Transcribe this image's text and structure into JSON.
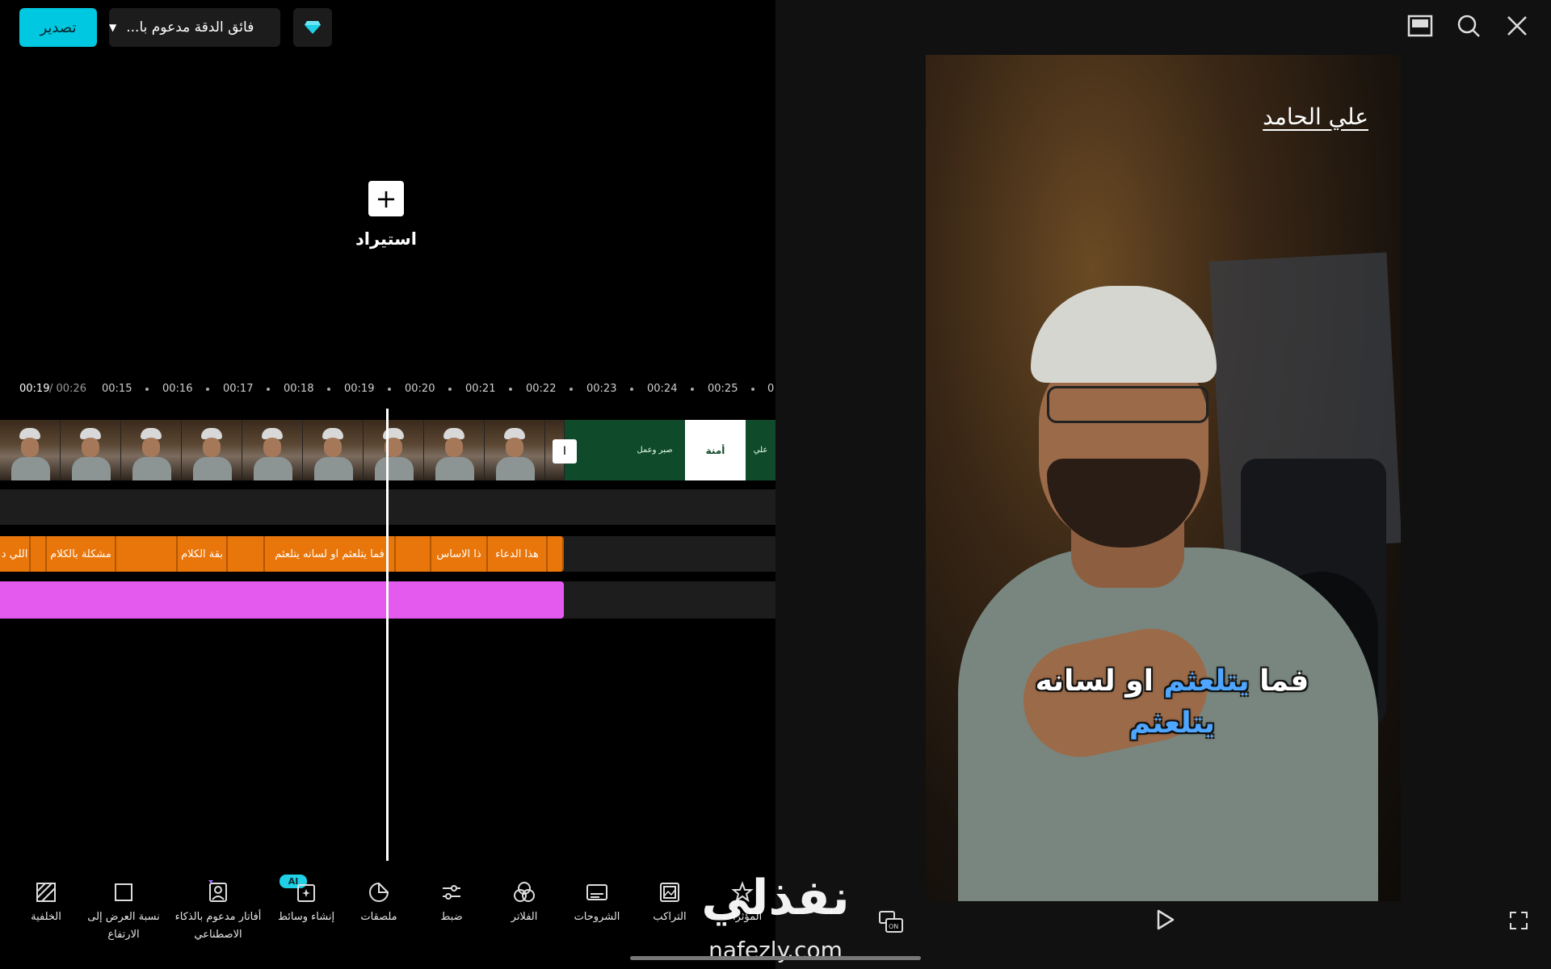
{
  "topbar": {
    "export_label": "تصدير",
    "resolution_label": "فائق الدقة مدعوم با..."
  },
  "import": {
    "plus": "+",
    "label": "استيراد"
  },
  "timeline": {
    "current_time": "00:19",
    "total_time": "/ 00:26",
    "ticks": [
      "00:15",
      "00:16",
      "00:17",
      "00:18",
      "00:19",
      "00:20",
      "00:21",
      "00:22",
      "00:23",
      "00:24",
      "00:25",
      "0"
    ],
    "clips": {
      "green_1": "",
      "green_2": "صبر وعمل",
      "white_card": "أمنة",
      "green_3": "علي"
    },
    "split_marker": "I",
    "subtitles": [
      "اللي د",
      "مشكلة بالكلام",
      "بقة الكلام",
      "فما يتلعثم او لسانه يتلعثم",
      "ذا الاساس",
      "هذا الدعاء"
    ]
  },
  "toolbar": {
    "background": "الخلفية",
    "aspect_line1": "نسبة العرض إلى",
    "aspect_line2": "الارتفاع",
    "avatar_line1": "أفاتار مدعوم بالذكاء",
    "avatar_line2": "الاصطناعي",
    "ai_badge": "AI",
    "create_media": "إنشاء وسائط",
    "stickers": "ملصقات",
    "adjust": "ضبط",
    "filters": "الفلاتر",
    "captions": "الشروحات",
    "overlays": "التراكب",
    "effects": "المؤثرات"
  },
  "preview": {
    "name_overlay": "علي الحامد",
    "subtitle_line1_a": "فما",
    "subtitle_line1_b": "يتلعثم",
    "subtitle_line1_c": "او",
    "subtitle_line1_d": "لسانه",
    "subtitle_line2": "يتلعثم"
  },
  "watermark": {
    "arabic": "نفذلي",
    "url": "nafezly.com"
  },
  "colors": {
    "accent": "#00c8e0",
    "subtitle_clip": "#e9760a",
    "audio_clip": "#e45aef"
  }
}
